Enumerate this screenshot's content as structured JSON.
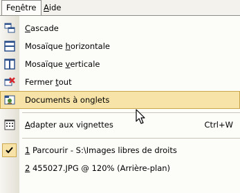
{
  "menubar": {
    "fenetre": "Fenêtre",
    "aide": "Aide"
  },
  "menu": {
    "items": [
      {
        "label_pre": "",
        "label_u": "C",
        "label_post": "ascade",
        "icon": "cascade-icon"
      },
      {
        "label_pre": "Mosaïque ",
        "label_u": "h",
        "label_post": "orizontale",
        "icon": "tile-horizontal-icon"
      },
      {
        "label_pre": "Mosaïque ",
        "label_u": "v",
        "label_post": "erticale",
        "icon": "tile-vertical-icon"
      },
      {
        "label_pre": "Fermer ",
        "label_u": "t",
        "label_post": "out",
        "icon": "close-all-icon"
      },
      {
        "label_pre": "Documents à on",
        "label_u": "g",
        "label_post": "lets",
        "icon": "tabbed-documents-icon",
        "highlighted": true
      },
      {
        "label_pre": "",
        "label_u": "A",
        "label_post": "dapter aux vignettes",
        "icon": "fit-thumbnails-icon",
        "shortcut": "Ctrl+W"
      },
      {
        "label_pre": "",
        "label_u": "1",
        "label_post": " Parcourir - S:\\Images libres de droits",
        "checked": true
      },
      {
        "label_pre": "",
        "label_u": "2",
        "label_post": " 455027.JPG @ 120% (Arrière-plan)"
      }
    ]
  }
}
